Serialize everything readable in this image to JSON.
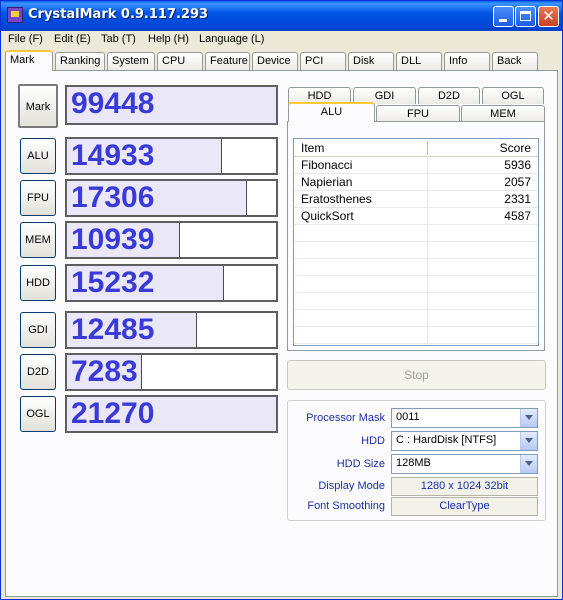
{
  "window": {
    "title": "CrystalMark 0.9.117.293"
  },
  "menu": [
    "File (F)",
    "Edit (E)",
    "Tab (T)",
    "Help (H)",
    "Language (L)"
  ],
  "tabs": [
    "Mark",
    "Ranking",
    "System",
    "CPU",
    "Feature",
    "Device",
    "PCI",
    "Disk",
    "DLL",
    "Info",
    "Back"
  ],
  "active_tab": "Mark",
  "scores": {
    "mark": {
      "label": "Mark",
      "value": "99448",
      "fill": 1.0
    },
    "alu": {
      "label": "ALU",
      "value": "14933",
      "fill": 0.74
    },
    "fpu": {
      "label": "FPU",
      "value": "17306",
      "fill": 0.86
    },
    "mem": {
      "label": "MEM",
      "value": "10939",
      "fill": 0.54
    },
    "hdd": {
      "label": "HDD",
      "value": "15232",
      "fill": 0.75
    },
    "gdi": {
      "label": "GDI",
      "value": "12485",
      "fill": 0.62
    },
    "d2d": {
      "label": "D2D",
      "value": "7283",
      "fill": 0.36
    },
    "ogl": {
      "label": "OGL",
      "value": "21270",
      "fill": 1.0
    }
  },
  "subtabs_top": [
    "HDD",
    "GDI",
    "D2D",
    "OGL"
  ],
  "subtabs_bottom": [
    "ALU",
    "FPU",
    "MEM"
  ],
  "active_subtab": "ALU",
  "results": {
    "header": {
      "item": "Item",
      "score": "Score"
    },
    "rows": [
      {
        "item": "Fibonacci",
        "score": "5936"
      },
      {
        "item": "Napierian",
        "score": "2057"
      },
      {
        "item": "Eratosthenes",
        "score": "2331"
      },
      {
        "item": "QuickSort",
        "score": "4587"
      }
    ]
  },
  "stop_button": "Stop",
  "settings": {
    "processor_mask": {
      "label": "Processor Mask",
      "value": "0011"
    },
    "hdd": {
      "label": "HDD",
      "value": "C : HardDisk [NTFS]"
    },
    "hdd_size": {
      "label": "HDD Size",
      "value": "128MB"
    },
    "display_mode": {
      "label": "Display Mode",
      "value": "1280 x 1024 32bit"
    },
    "font_smoothing": {
      "label": "Font Smoothing",
      "value": "ClearType"
    }
  },
  "colors": {
    "score_text": "#3a3ad8",
    "bar_fill": "#eae8f8",
    "title_blue": "#0055e5",
    "label_blue": "#1830a8"
  }
}
